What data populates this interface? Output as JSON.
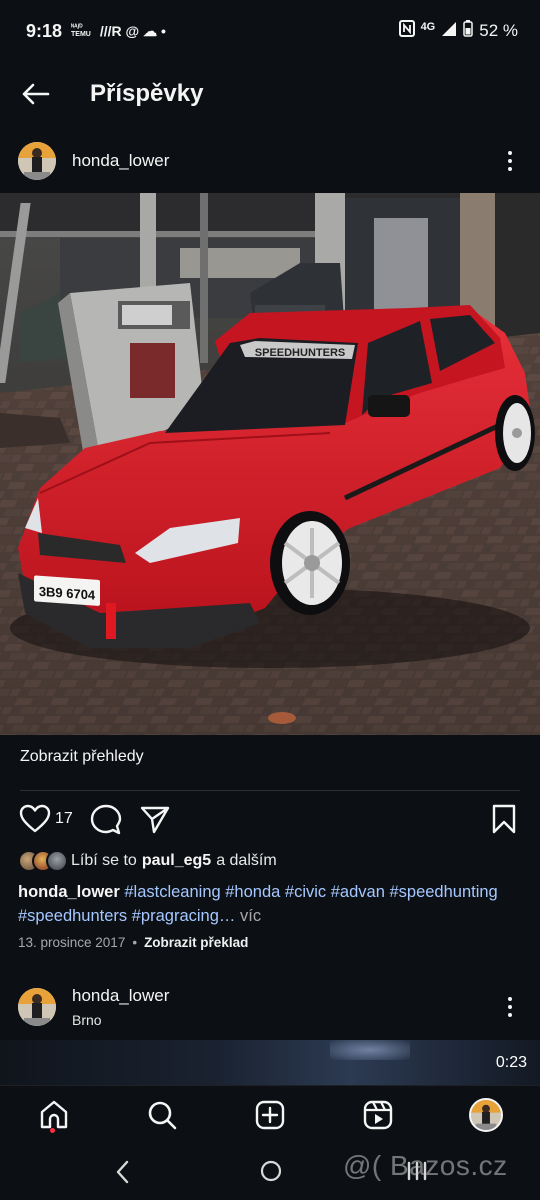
{
  "status_bar": {
    "time": "9:18",
    "small_top": "ᴺᴬ/ᴰ",
    "small_bottom": "TEMU",
    "glyphs": "///R @ ☁ •",
    "network": "4G",
    "battery": "52 %"
  },
  "header": {
    "title": "Příspěvky"
  },
  "post1": {
    "username": "honda_lower",
    "insights": "Zobrazit přehledy",
    "like_count": "17",
    "likes_prefix": "Líbí se to",
    "likes_user": "paul_eg5",
    "likes_suffix": "a dalším",
    "caption_user": "honda_lower",
    "caption_tags": "#lastcleaning #honda #civic #advan #speedhunting #speedhunters #pragracing…",
    "caption_more": "víc",
    "date": "13. prosince 2017",
    "translate": "Zobrazit překlad",
    "photo": {
      "windshield_banner": "SPEEDHUNTERS",
      "license_plate": "3B9 6704"
    }
  },
  "post2": {
    "username": "honda_lower",
    "location": "Brno",
    "video_time": "0:23"
  },
  "icons": {
    "back": "arrow-left",
    "more": "three-dots",
    "like": "heart",
    "comment": "speech-bubble",
    "share": "paper-plane",
    "save": "bookmark",
    "home": "house",
    "search": "magnifier",
    "create": "plus-square",
    "reels": "play-square",
    "profile": "avatar"
  },
  "watermark": "@( Bazos.cz",
  "colors": {
    "background": "#0c1014",
    "hashtag": "#a5c7ff",
    "car_red": "#d11a26",
    "notification": "#ff3040"
  }
}
